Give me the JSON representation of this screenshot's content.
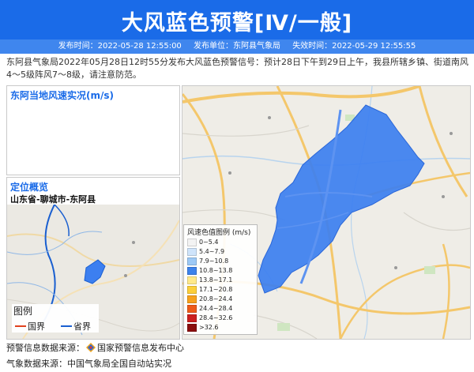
{
  "header": {
    "title": "大风蓝色预警[Ⅳ/一般]"
  },
  "meta": {
    "publish_time": "发布时间：2022-05-28 12:55:00",
    "publisher": "发布单位：东阿县气象局",
    "expire_time": "失效时间：2022-05-29 12:55:55"
  },
  "description": "东阿县气象局2022年05月28日12时55分发布大风蓝色预警信号：预计28日下午到29日上午，我县所辖乡镇、街道南风4～5级阵风7～8级，请注意防范。",
  "wind_panel": {
    "title": "东阿当地风速实况(m/s)"
  },
  "location_panel": {
    "title": "定位概览",
    "location": "山东省-聊城市-东阿县"
  },
  "mini_legend": {
    "title": "图例",
    "items": [
      {
        "label": "国界",
        "color": "#e0421e"
      },
      {
        "label": "省界",
        "color": "#1a5fd0"
      }
    ]
  },
  "wind_legend": {
    "title": "风速色值图例 (m/s)",
    "items": [
      {
        "label": "0~5.4",
        "color": "#f3f3f3"
      },
      {
        "label": "5.4~7.9",
        "color": "#cfe4fb"
      },
      {
        "label": "7.9~10.8",
        "color": "#9dc9f6"
      },
      {
        "label": "10.8~13.8",
        "color": "#3c82ec"
      },
      {
        "label": "13.8~17.1",
        "color": "#ffe98a"
      },
      {
        "label": "17.1~20.8",
        "color": "#fccf3a"
      },
      {
        "label": "20.8~24.4",
        "color": "#f7a11c"
      },
      {
        "label": "24.4~28.4",
        "color": "#ee5a18"
      },
      {
        "label": "28.4~32.6",
        "color": "#cc1f1f"
      },
      {
        "label": ">32.6",
        "color": "#8b0d0d"
      }
    ]
  },
  "sources": {
    "warning_source": "预警信息数据来源：",
    "warning_org": "国家预警信息发布中心",
    "weather_source": "气象数据来源：中国气象局全国自动站实况"
  },
  "colors": {
    "header_blue": "#1a6be8",
    "warning_area": "#3c7ff0"
  }
}
